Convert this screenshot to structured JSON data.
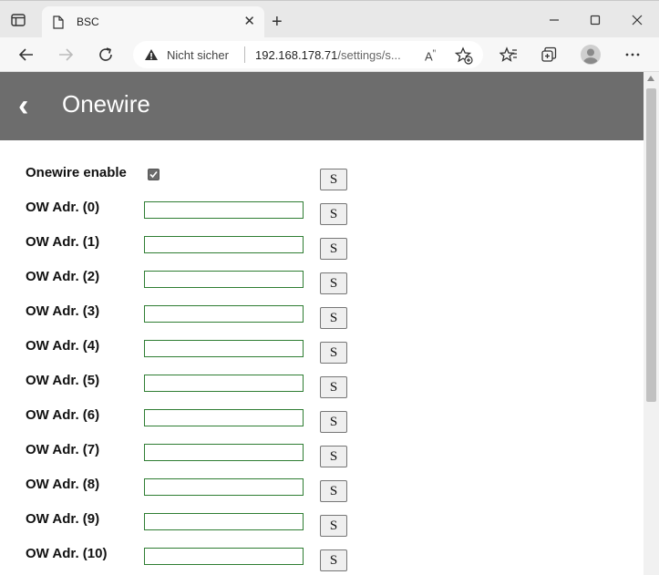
{
  "browser": {
    "tab_title": "BSC",
    "security_label": "Nicht sicher",
    "url_host": "192.168.178.71",
    "url_path": "/settings/s...",
    "read_aloud": "A⁵",
    "icons": [
      "tab-actions-icon",
      "page-icon",
      "close-icon",
      "plus-icon",
      "minimize-icon",
      "maximize-icon",
      "close-window-icon",
      "back-arrow-icon",
      "forward-arrow-icon",
      "refresh-icon",
      "warning-icon",
      "read-aloud-icon",
      "add-favorite-icon",
      "favorites-icon",
      "collections-icon",
      "profile-icon",
      "more-icon"
    ]
  },
  "page": {
    "back_glyph": "‹",
    "title": "Onewire",
    "header_color": "#6d6d6d",
    "input_border_color": "#2e7d32",
    "save_label": "S",
    "onewire_enable": {
      "label": "Onewire enable",
      "checked": true
    },
    "addresses": [
      {
        "label": "OW Adr. (0)",
        "value": ""
      },
      {
        "label": "OW Adr. (1)",
        "value": ""
      },
      {
        "label": "OW Adr. (2)",
        "value": ""
      },
      {
        "label": "OW Adr. (3)",
        "value": ""
      },
      {
        "label": "OW Adr. (4)",
        "value": ""
      },
      {
        "label": "OW Adr. (5)",
        "value": ""
      },
      {
        "label": "OW Adr. (6)",
        "value": ""
      },
      {
        "label": "OW Adr. (7)",
        "value": ""
      },
      {
        "label": "OW Adr. (8)",
        "value": ""
      },
      {
        "label": "OW Adr. (9)",
        "value": ""
      },
      {
        "label": "OW Adr. (10)",
        "value": ""
      }
    ]
  }
}
